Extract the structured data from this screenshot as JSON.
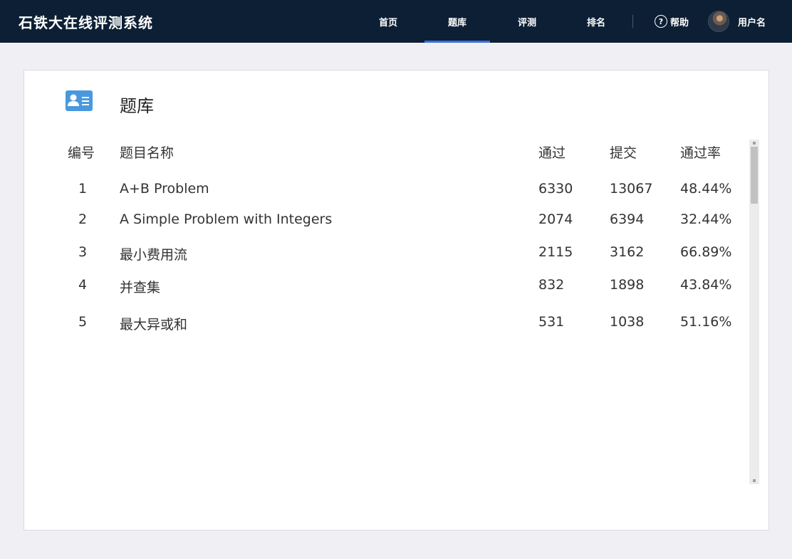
{
  "header": {
    "brand": "石铁大在线评测系统",
    "nav": [
      {
        "label": "首页",
        "active": false
      },
      {
        "label": "题库",
        "active": true
      },
      {
        "label": "评测",
        "active": false
      },
      {
        "label": "排名",
        "active": false
      }
    ],
    "help_label": "帮助",
    "help_icon": "question-circle-icon",
    "username": "用户名"
  },
  "card": {
    "icon": "id-card-icon",
    "icon_color": "#4a98dd",
    "title": "题库",
    "columns": [
      "编号",
      "题目名称",
      "通过",
      "提交",
      "通过率"
    ],
    "rows": [
      {
        "id": "1",
        "name": "A+B Problem",
        "passed": "6330",
        "submitted": "13067",
        "rate": "48.44%"
      },
      {
        "id": "2",
        "name": "A Simple Problem with Integers",
        "passed": "2074",
        "submitted": "6394",
        "rate": "32.44%"
      },
      {
        "id": "3",
        "name": "最小费用流",
        "passed": "2115",
        "submitted": "3162",
        "rate": "66.89%"
      },
      {
        "id": "4",
        "name": "并查集",
        "passed": "832",
        "submitted": "1898",
        "rate": "43.84%"
      },
      {
        "id": "5",
        "name": "最大异或和",
        "passed": "531",
        "submitted": "1038",
        "rate": "51.16%"
      }
    ]
  },
  "colors": {
    "topbar": "#0c1f34",
    "active_underline": "#3b6fe0",
    "background": "#f0f0f4"
  }
}
